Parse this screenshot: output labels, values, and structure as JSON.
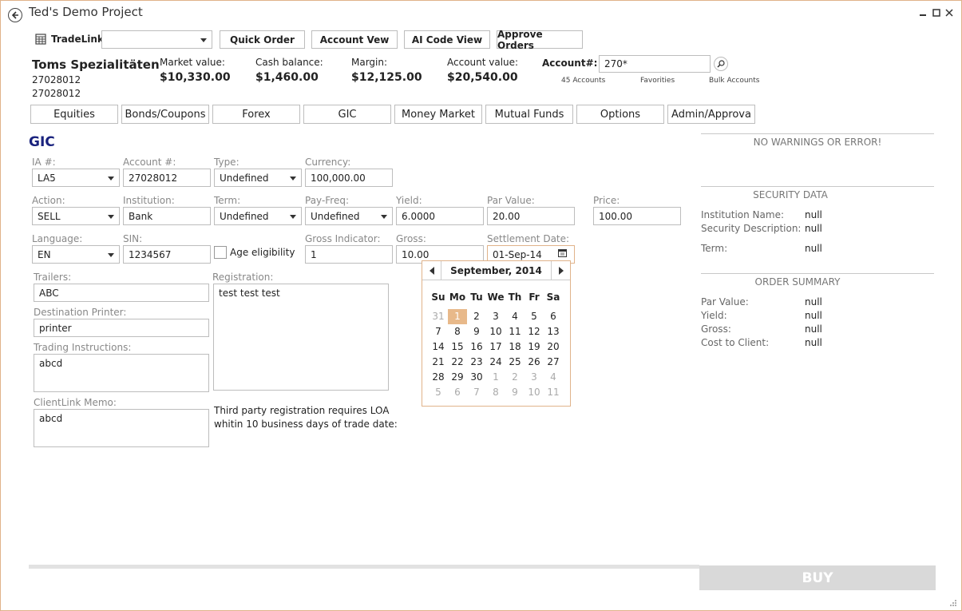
{
  "window": {
    "title": "Ted's Demo Project"
  },
  "toolbar": {
    "tradelink_label": "TradeLink",
    "combo_value": "",
    "buttons": [
      "Quick Order",
      "Account Vew",
      "AI Code View",
      "Approve Orders"
    ]
  },
  "account": {
    "name": "Toms Spezialitäten",
    "id1": "27028012",
    "id2": "27028012",
    "market_value_label": "Market value:",
    "market_value": "$10,330.00",
    "cash_balance_label": "Cash balance:",
    "cash_balance": "$1,460.00",
    "margin_label": "Margin:",
    "margin": "$12,125.00",
    "account_value_label": "Account value:",
    "account_value": "$20,540.00",
    "account_num_label": "Account#:",
    "account_num_value": "270*",
    "links": [
      "45 Accounts",
      "Favorities",
      "Bulk Accounts"
    ]
  },
  "tabs": [
    "Equities",
    "Bonds/Coupons",
    "Forex",
    "GIC",
    "Money Market",
    "Mutual Funds",
    "Options",
    "Admin/Approva"
  ],
  "form": {
    "title": "GIC",
    "ia_label": "IA #:",
    "ia_value": "LA5",
    "account_label": "Account #:",
    "account_value": "27028012",
    "type_label": "Type:",
    "type_value": "Undefined",
    "currency_label": "Currency:",
    "currency_value": "100,000.00",
    "action_label": "Action:",
    "action_value": "SELL",
    "institution_label": "Institution:",
    "institution_value": "Bank",
    "term_label": "Term:",
    "term_value": "Undefined",
    "payfreq_label": "Pay-Freq:",
    "payfreq_value": "Undefined",
    "yield_label": "Yield:",
    "yield_value": "6.0000",
    "par_label": "Par Value:",
    "par_value": "20.00",
    "price_label": "Price:",
    "price_value": "100.00",
    "language_label": "Language:",
    "language_value": "EN",
    "sin_label": "SIN:",
    "sin_value": "1234567",
    "age_label": "Age eligibility",
    "gross_ind_label": "Gross Indicator:",
    "gross_ind_value": "1",
    "gross_label": "Gross:",
    "gross_value": "10.00",
    "settle_label": "Settlement Date:",
    "settle_value": "01-Sep-14",
    "trailers_label": "Trailers:",
    "trailers_value": "ABC",
    "registration_label": "Registration:",
    "registration_value": "test test test",
    "printer_label": "Destination Printer:",
    "printer_value": "printer",
    "trading_label": "Trading Instructions:",
    "trading_value": "abcd",
    "memo_label": "ClientLink Memo:",
    "memo_value": "abcd",
    "loa_note_line1": "Third party registration requires LOA",
    "loa_note_line2": "whitin 10 business days of trade date:"
  },
  "calendar": {
    "month_label": "September, 2014",
    "dow": [
      "Su",
      "Mo",
      "Tu",
      "We",
      "Th",
      "Fr",
      "Sa"
    ],
    "weeks": [
      [
        "31",
        "1",
        "2",
        "3",
        "4",
        "5",
        "6"
      ],
      [
        "7",
        "8",
        "9",
        "10",
        "11",
        "12",
        "13"
      ],
      [
        "14",
        "15",
        "16",
        "17",
        "18",
        "19",
        "20"
      ],
      [
        "21",
        "22",
        "23",
        "24",
        "25",
        "26",
        "27"
      ],
      [
        "28",
        "29",
        "30",
        "1",
        "2",
        "3",
        "4"
      ],
      [
        "5",
        "6",
        "7",
        "8",
        "9",
        "10",
        "11"
      ]
    ]
  },
  "side": {
    "warnings": "NO WARNINGS OR ERROR!",
    "security_title": "SECURITY DATA",
    "institution_name_label": "Institution Name:",
    "institution_name_value": "null",
    "security_desc_label": "Security Description:",
    "security_desc_value": "null",
    "term_label": "Term:",
    "term_value": "null",
    "order_title": "ORDER SUMMARY",
    "par_label": "Par Value:",
    "par_value": "null",
    "yield_label": "Yield:",
    "yield_value": "null",
    "gross_label": "Gross:",
    "gross_value": "null",
    "cost_label": "Cost to Client:",
    "cost_value": "null"
  },
  "footer": {
    "buy_label": "BUY"
  },
  "colors": {
    "accent": "#e0b38a",
    "title_blue": "#1a237e",
    "selected_day": "#e8b98a"
  }
}
